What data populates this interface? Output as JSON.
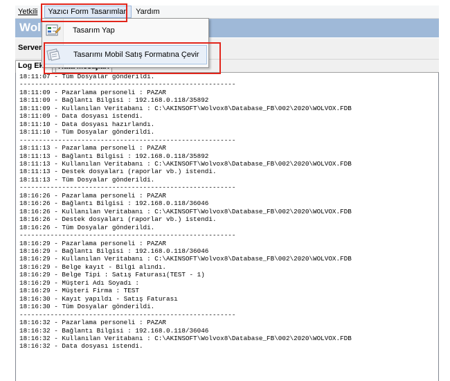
{
  "menu": {
    "items": [
      "Yetkili",
      "Yazıcı Form Tasarımları",
      "Yardım"
    ]
  },
  "window": {
    "title_fragment": "Wol"
  },
  "server": {
    "label": "Server"
  },
  "tabs": [
    "Log Ek...",
    "Hata Mesajları"
  ],
  "dropdown": {
    "items": [
      {
        "label": "Tasarım Yap",
        "icon": "form-design-icon"
      },
      {
        "label": "Tasarımı Mobil Satış Formatına Çevir",
        "icon": "mobile-convert-icon"
      }
    ]
  },
  "annotation_color": "#e1251b",
  "log_lines": [
    "18:11:07 - Tüm Dosyalar gönderildi.",
    "--------------------------------------------------------",
    "18:11:09 - Pazarlama personeli : PAZAR",
    "18:11:09 - Bağlantı Bilgisi : 192.168.0.118/35892",
    "18:11:09 - Kullanılan Veritabanı : C:\\AKINSOFT\\Wolvox8\\Database_FB\\002\\2020\\WOLVOX.FDB",
    "18:11:09 - Data dosyası istendi.",
    "18:11:10 - Data dosyası hazırlandı.",
    "18:11:10 - Tüm Dosyalar gönderildi.",
    "--------------------------------------------------------",
    "18:11:13 - Pazarlama personeli : PAZAR",
    "18:11:13 - Bağlantı Bilgisi : 192.168.0.118/35892",
    "18:11:13 - Kullanılan Veritabanı : C:\\AKINSOFT\\Wolvox8\\Database_FB\\002\\2020\\WOLVOX.FDB",
    "18:11:13 - Destek dosyaları (raporlar vb.) istendi.",
    "18:11:13 - Tüm Dosyalar gönderildi.",
    "--------------------------------------------------------",
    "18:16:26 - Pazarlama personeli : PAZAR",
    "18:16:26 - Bağlantı Bilgisi : 192.168.0.118/36046",
    "18:16:26 - Kullanılan Veritabanı : C:\\AKINSOFT\\Wolvox8\\Database_FB\\002\\2020\\WOLVOX.FDB",
    "18:16:26 - Destek dosyaları (raporlar vb.) istendi.",
    "18:16:26 - Tüm Dosyalar gönderildi.",
    "--------------------------------------------------------",
    "18:16:29 - Pazarlama personeli : PAZAR",
    "18:16:29 - Bağlantı Bilgisi : 192.168.0.118/36046",
    "18:16:29 - Kullanılan Veritabanı : C:\\AKINSOFT\\Wolvox8\\Database_FB\\002\\2020\\WOLVOX.FDB",
    "18:16:29 - Belge kayıt - Bilgi alındı.",
    "18:16:29 - Belge Tipi : Satış Faturası(TEST - 1)",
    "18:16:29 - Müşteri Adı Soyadı :",
    "18:16:29 - Müşteri Firma : TEST",
    "18:16:30 - Kayıt yapıldı - Satış Faturası",
    "18:16:30 - Tüm Dosyalar gönderildi.",
    "--------------------------------------------------------",
    "18:16:32 - Pazarlama personeli : PAZAR",
    "18:16:32 - Bağlantı Bilgisi : 192.168.0.118/36046",
    "18:16:32 - Kullanılan Veritabanı : C:\\AKINSOFT\\Wolvox8\\Database_FB\\002\\2020\\WOLVOX.FDB",
    "18:16:32 - Data dosyası istendi."
  ]
}
